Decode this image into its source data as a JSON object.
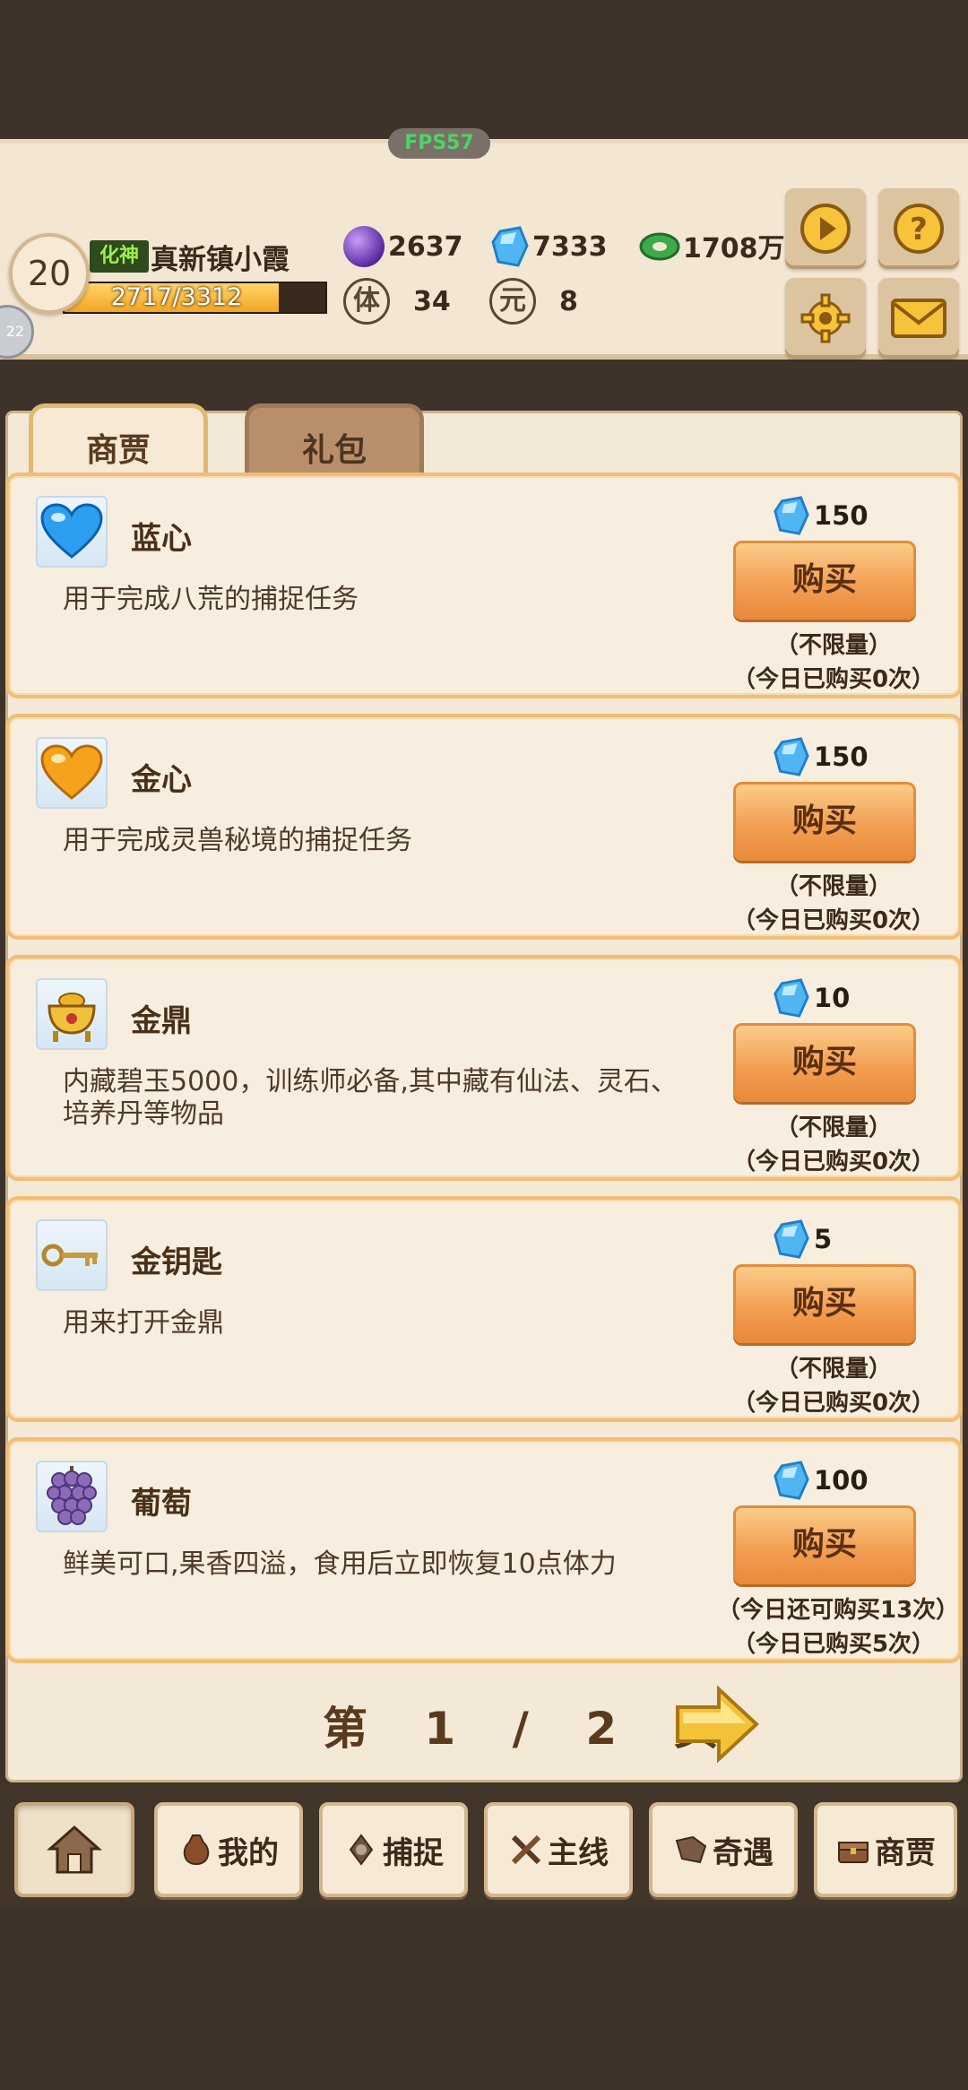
{
  "status": {
    "fps": "FPS57"
  },
  "player": {
    "level": "20",
    "avatar_badge": "22",
    "realm": "化神",
    "name": "真新镇小霞",
    "exp_text": "2717/3312",
    "exp_fraction": 0.82
  },
  "resources": {
    "purple_gem": "2637",
    "blue_gem": "7333",
    "jade": "1708万"
  },
  "stats": {
    "stamina_glyph": "体",
    "stamina": "34",
    "yuan_glyph": "元",
    "yuan": "8"
  },
  "tabs": [
    {
      "label": "商贾",
      "active": true
    },
    {
      "label": "礼包",
      "active": false
    }
  ],
  "items": [
    {
      "name": "蓝心",
      "desc": "用于完成八荒的捕捉任务",
      "price": "150",
      "buy": "购买",
      "limit1": "（不限量）",
      "limit2": "（今日已购买0次）",
      "icon": "blue-heart-icon"
    },
    {
      "name": "金心",
      "desc": "用于完成灵兽秘境的捕捉任务",
      "price": "150",
      "buy": "购买",
      "limit1": "（不限量）",
      "limit2": "（今日已购买0次）",
      "icon": "gold-heart-icon"
    },
    {
      "name": "金鼎",
      "desc": "内藏碧玉5000，训练师必备,其中藏有仙法、灵石、培养丹等物品",
      "price": "10",
      "buy": "购买",
      "limit1": "（不限量）",
      "limit2": "（今日已购买0次）",
      "icon": "gold-cauldron-icon"
    },
    {
      "name": "金钥匙",
      "desc": "用来打开金鼎",
      "price": "5",
      "buy": "购买",
      "limit1": "（不限量）",
      "limit2": "（今日已购买0次）",
      "icon": "gold-key-icon"
    },
    {
      "name": "葡萄",
      "desc": "鲜美可口,果香四溢，食用后立即恢复10点体力",
      "price": "100",
      "buy": "购买",
      "limit1": "（今日还可购买13次）",
      "limit2": "（今日已购买5次）",
      "icon": "grape-icon"
    }
  ],
  "pager": {
    "prefix": "第",
    "current": "1",
    "sep": "/",
    "total": "2",
    "suffix": "页"
  },
  "nav": [
    {
      "label": "",
      "icon": "home-icon"
    },
    {
      "label": "我的",
      "icon": "bag-icon"
    },
    {
      "label": "捕捉",
      "icon": "capture-icon"
    },
    {
      "label": "主线",
      "icon": "swords-icon"
    },
    {
      "label": "奇遇",
      "icon": "adventure-icon"
    },
    {
      "label": "商贾",
      "icon": "chest-icon"
    }
  ],
  "colors": {
    "accent_orange": "#f3a053",
    "card_border": "#f0be78",
    "panel_bg": "#f4e9d6",
    "header_bg": "#f3e6d2"
  }
}
